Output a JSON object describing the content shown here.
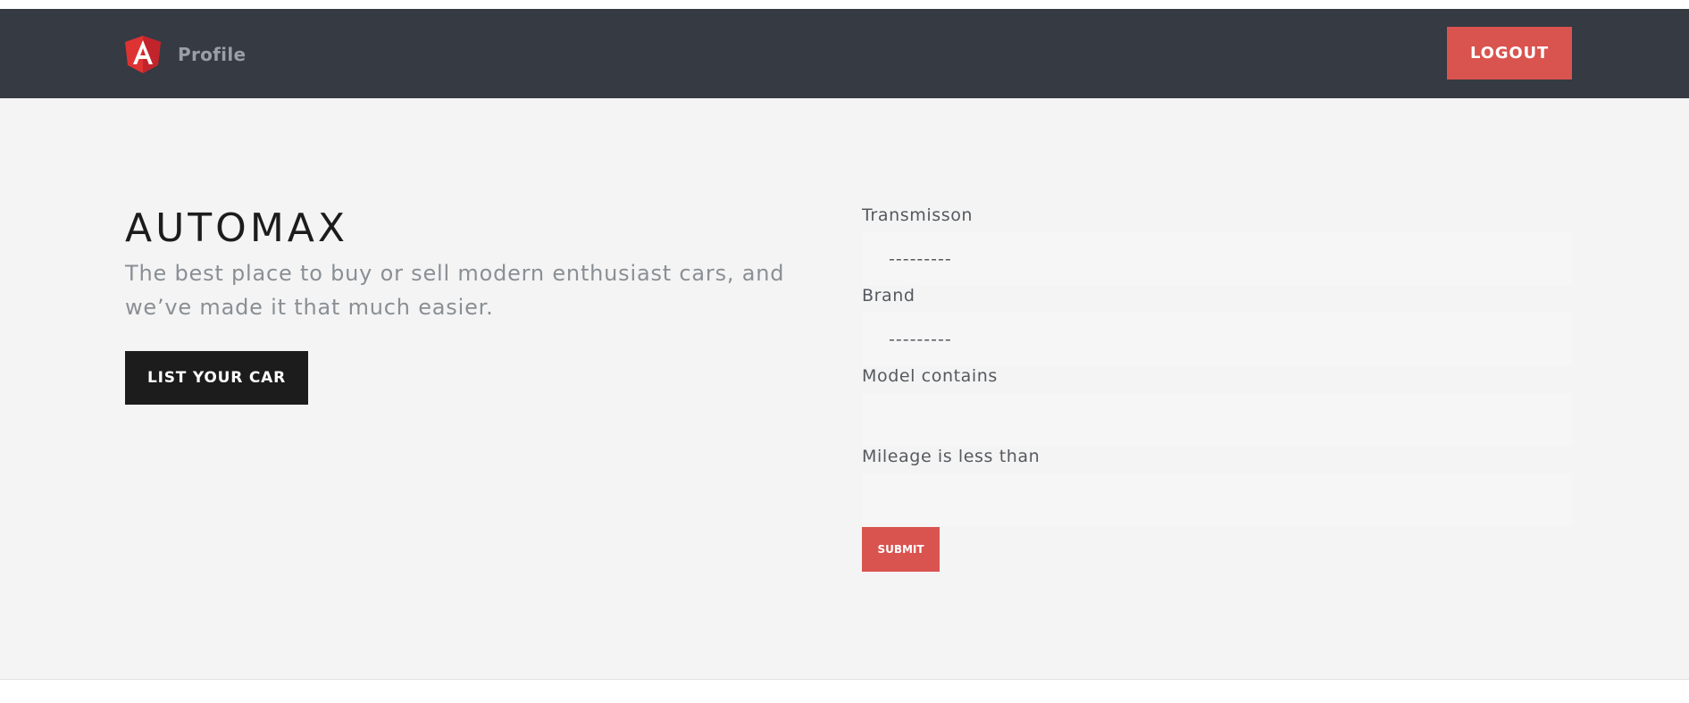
{
  "navbar": {
    "brand_icon": "angular-logo-icon",
    "profile_label": "Profile",
    "logout_label": "LOGOUT",
    "background_color": "#353a43",
    "accent_color": "#d9534f"
  },
  "hero": {
    "title": "AUTOMAX",
    "description": "The best place to buy or sell modern enthusiast cars, and we’ve made it that much easier.",
    "list_button_label": "LIST YOUR CAR"
  },
  "search_form": {
    "transmission": {
      "label": "Transmisson",
      "value": "---------"
    },
    "brand": {
      "label": "Brand",
      "value": "---------"
    },
    "model": {
      "label": "Model contains",
      "value": ""
    },
    "mileage": {
      "label": "Mileage is less than",
      "value": ""
    },
    "submit_label": "SUBMIT"
  }
}
